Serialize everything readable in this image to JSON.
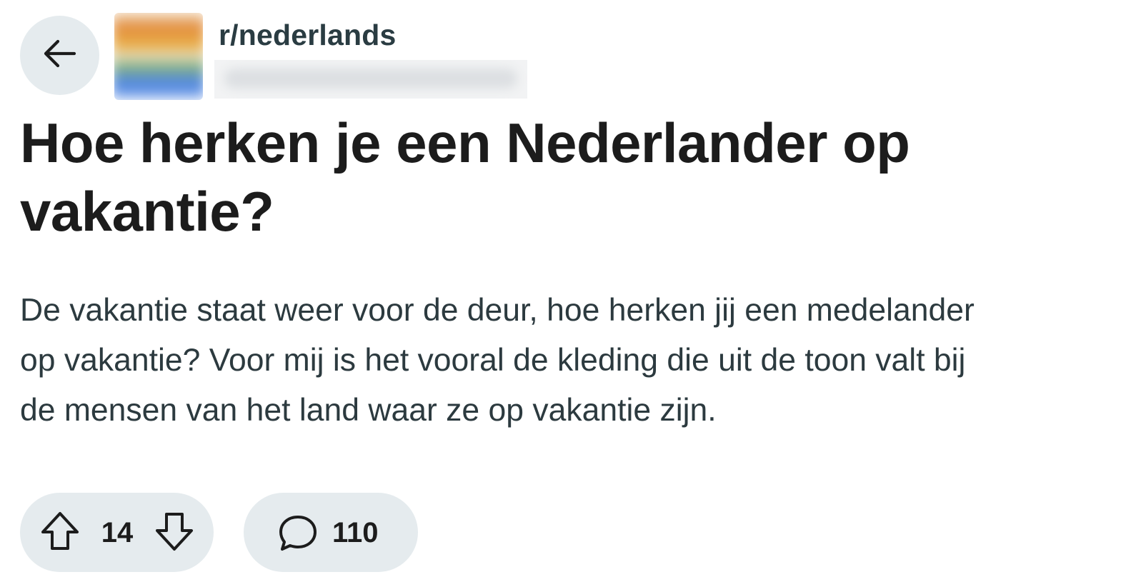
{
  "header": {
    "back_icon": "arrow-left-icon",
    "subreddit": "r/nederlands",
    "avatar_icon": "subreddit-avatar"
  },
  "post": {
    "title": "Hoe herken je een Nederlander op vakantie?",
    "body": "De vakantie staat weer voor de deur, hoe herken jij een medelander\nop vakantie? Voor mij is het vooral de kleding die uit de toon valt bij\nde mensen van het land waar ze op vakantie zijn."
  },
  "actions": {
    "upvote_icon": "arrow-up-icon",
    "downvote_icon": "arrow-down-icon",
    "vote_count": "14",
    "comment_icon": "comment-bubble-icon",
    "comment_count": "110"
  },
  "colors": {
    "pill_background": "#e5ebee",
    "title_text": "#1c1c1c",
    "body_text": "#2c3a3f",
    "subreddit_text": "#2a3c42"
  }
}
